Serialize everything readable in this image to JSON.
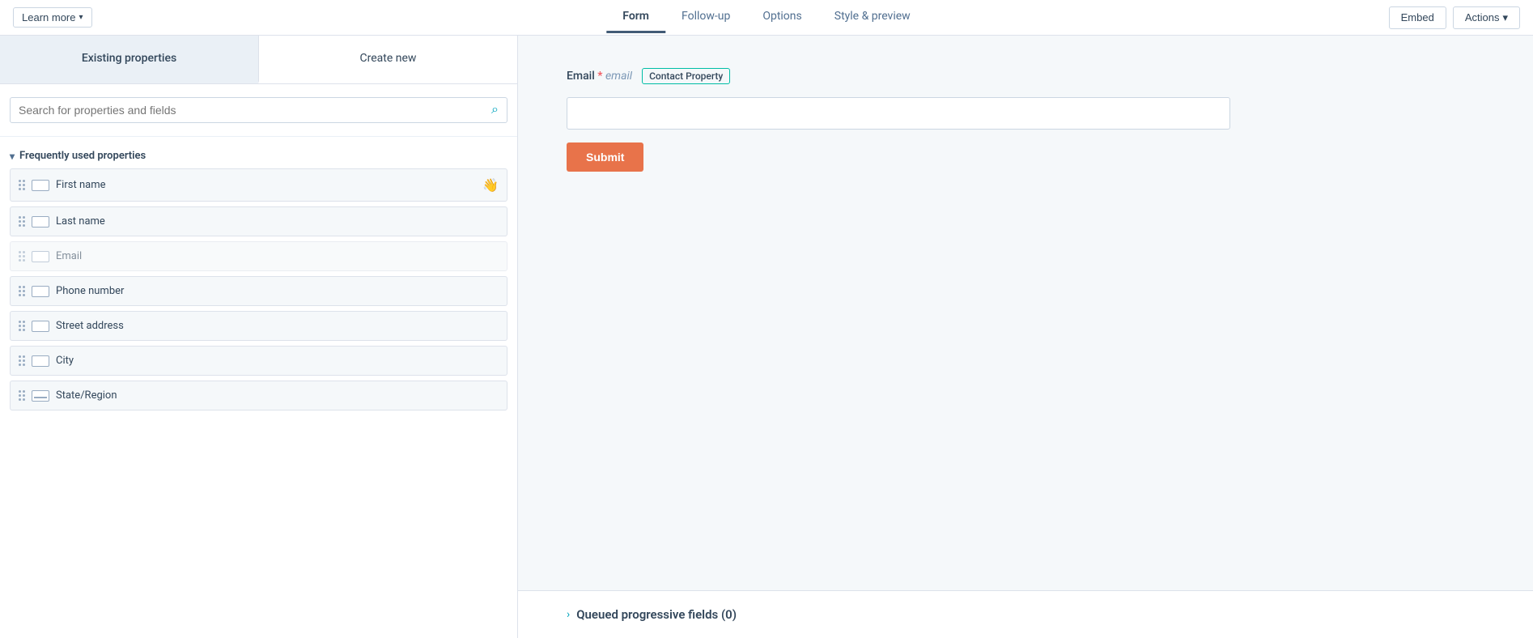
{
  "topNav": {
    "learnMore": "Learn more",
    "tabs": [
      {
        "id": "form",
        "label": "Form",
        "active": true
      },
      {
        "id": "followup",
        "label": "Follow-up",
        "active": false
      },
      {
        "id": "options",
        "label": "Options",
        "active": false
      },
      {
        "id": "stylepreview",
        "label": "Style & preview",
        "active": false
      }
    ],
    "embedLabel": "Embed",
    "actionsLabel": "Actions"
  },
  "leftPanel": {
    "tab1": "Existing properties",
    "tab2": "Create new",
    "searchPlaceholder": "Search for properties and fields",
    "sectionLabel": "Frequently used properties",
    "properties": [
      {
        "id": "firstname",
        "label": "First name",
        "disabled": false,
        "showCursor": true
      },
      {
        "id": "lastname",
        "label": "Last name",
        "disabled": false,
        "showCursor": false
      },
      {
        "id": "email",
        "label": "Email",
        "disabled": true,
        "showCursor": false
      },
      {
        "id": "phone",
        "label": "Phone number",
        "disabled": false,
        "showCursor": false
      },
      {
        "id": "address",
        "label": "Street address",
        "disabled": false,
        "showCursor": false
      },
      {
        "id": "city",
        "label": "City",
        "disabled": false,
        "showCursor": false
      },
      {
        "id": "state",
        "label": "State/Region",
        "disabled": false,
        "showCursor": false
      }
    ]
  },
  "formPreview": {
    "emailLabel": "Email",
    "required": "*",
    "fieldType": "email",
    "contactPropertyBadge": "Contact Property",
    "submitLabel": "Submit"
  },
  "queuedSection": {
    "label": "Queued progressive fields (0)"
  }
}
